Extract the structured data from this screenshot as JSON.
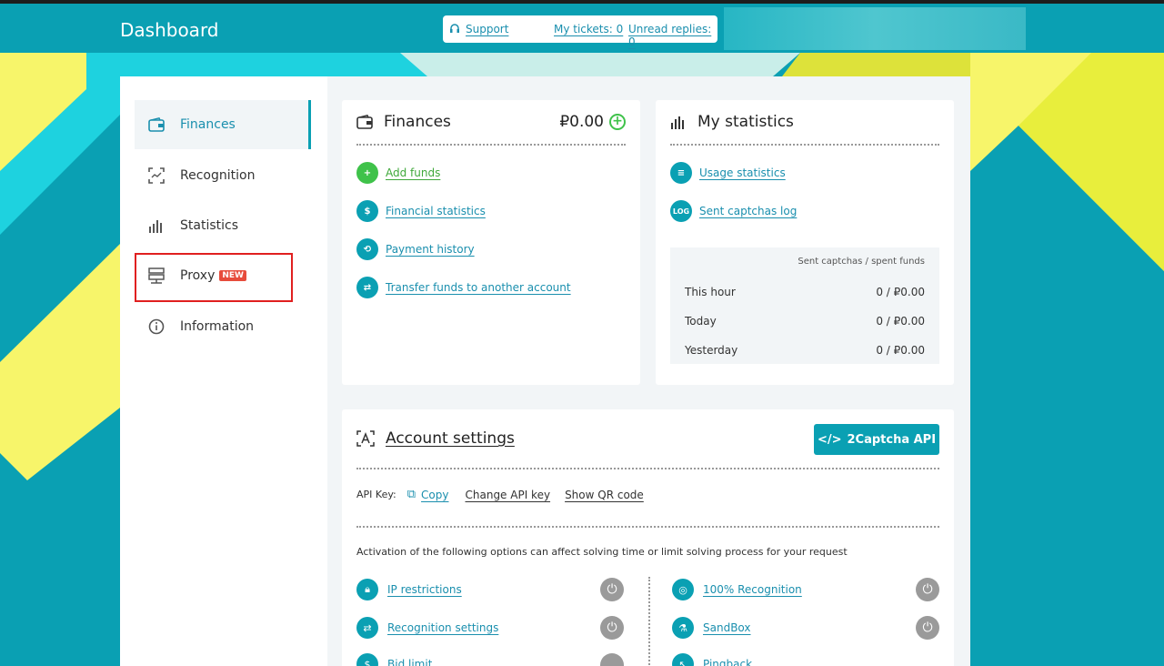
{
  "header": {
    "title": "Dashboard",
    "support": "Support",
    "my_tickets": "My tickets: 0",
    "unread_replies": "Unread replies: 0"
  },
  "sidebar": {
    "items": [
      {
        "label": "Finances",
        "icon": "wallet-icon"
      },
      {
        "label": "Recognition",
        "icon": "scan-icon"
      },
      {
        "label": "Statistics",
        "icon": "bar-chart-icon"
      },
      {
        "label": "Proxy",
        "icon": "server-icon",
        "badge": "NEW"
      },
      {
        "label": "Information",
        "icon": "info-icon"
      }
    ]
  },
  "finances": {
    "title": "Finances",
    "balance": "₽0.00",
    "links": [
      "Add funds",
      "Financial statistics",
      "Payment history",
      "Transfer funds to another account"
    ]
  },
  "statistics": {
    "title": "My statistics",
    "links": [
      "Usage statistics",
      "Sent captchas log"
    ],
    "log_icon_text": "LOG",
    "table_header": "Sent captchas / spent funds",
    "rows": [
      {
        "label": "This hour",
        "value": "0 / ₽0.00"
      },
      {
        "label": "Today",
        "value": "0 / ₽0.00"
      },
      {
        "label": "Yesterday",
        "value": "0 / ₽0.00"
      }
    ]
  },
  "account": {
    "title": "Account settings",
    "api_button": "2Captcha API",
    "api_key_label": "API Key:",
    "copy": "Copy",
    "change_key": "Change API key",
    "show_qr": "Show QR code",
    "note": "Activation of the following options can affect solving time or limit solving process for your request",
    "options_left": [
      "IP restrictions",
      "Recognition settings",
      "Bid limit"
    ],
    "options_right": [
      "100% Recognition",
      "SandBox",
      "Pingback"
    ]
  },
  "colors": {
    "teal": "#0aa0b3",
    "yellow": "#f7f56a",
    "green": "#3fc24a",
    "new_badge": "#e74c3c"
  }
}
